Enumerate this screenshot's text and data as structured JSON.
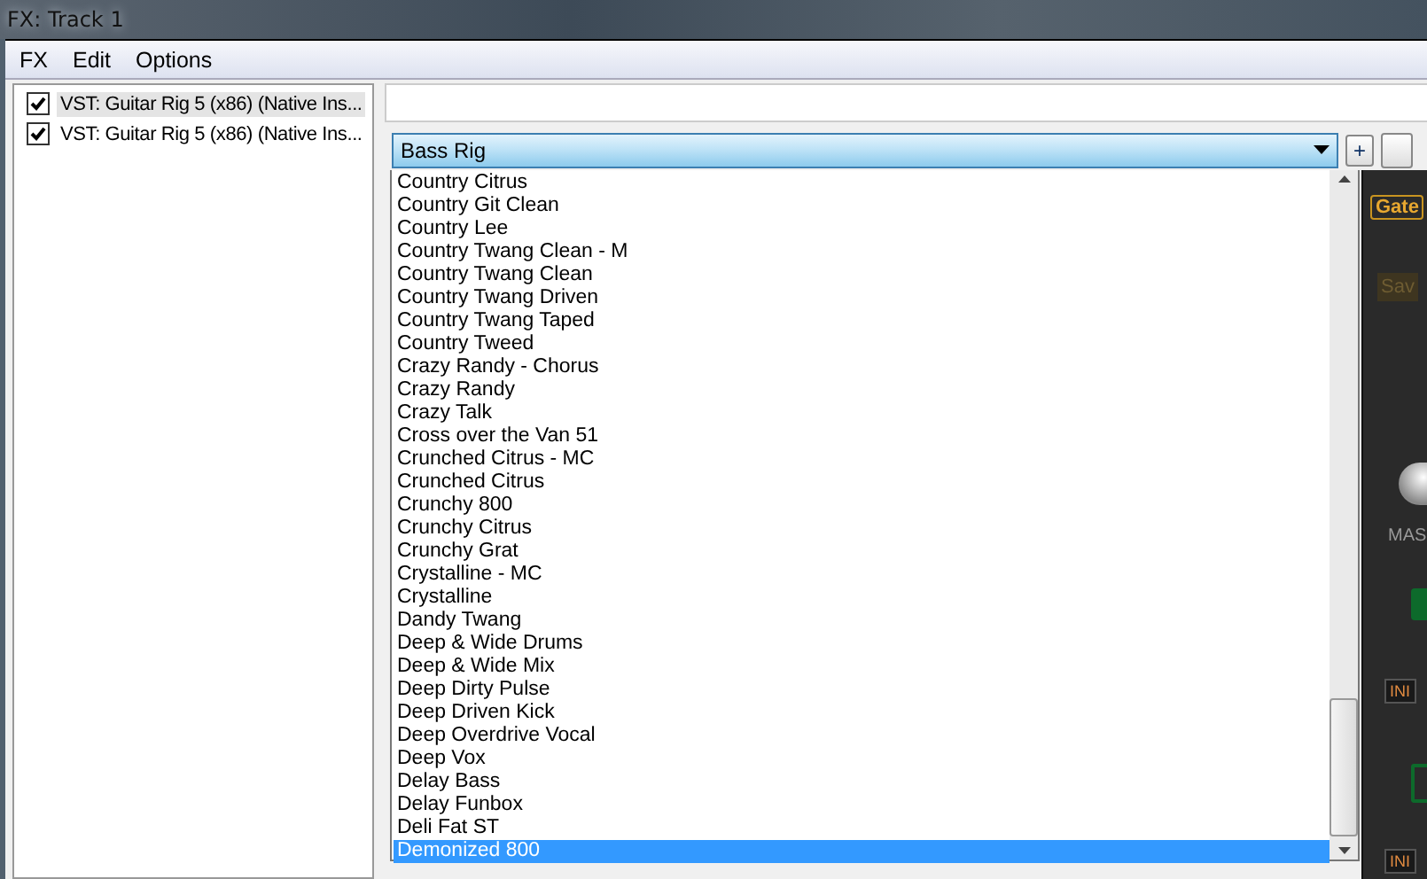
{
  "window": {
    "title": "FX: Track 1"
  },
  "menu": [
    "FX",
    "Edit",
    "Options"
  ],
  "fx_chain": [
    {
      "label": "VST: Guitar Rig 5 (x86) (Native Ins...",
      "checked": true,
      "selected": true
    },
    {
      "label": "VST: Guitar Rig 5 (x86) (Native Ins...",
      "checked": true,
      "selected": false
    }
  ],
  "preset": {
    "value": "Bass Rig",
    "add_button": "+"
  },
  "preset_list": [
    {
      "label": "Country Citrus",
      "selected": false
    },
    {
      "label": "Country Git Clean",
      "selected": false
    },
    {
      "label": "Country Lee",
      "selected": false
    },
    {
      "label": "Country Twang Clean - M",
      "selected": false
    },
    {
      "label": "Country Twang Clean",
      "selected": false
    },
    {
      "label": "Country Twang Driven",
      "selected": false
    },
    {
      "label": "Country Twang Taped",
      "selected": false
    },
    {
      "label": "Country Tweed",
      "selected": false
    },
    {
      "label": "Crazy Randy - Chorus",
      "selected": false
    },
    {
      "label": "Crazy Randy",
      "selected": false
    },
    {
      "label": "Crazy Talk",
      "selected": false
    },
    {
      "label": "Cross over the Van 51",
      "selected": false
    },
    {
      "label": "Crunched Citrus - MC",
      "selected": false
    },
    {
      "label": "Crunched Citrus",
      "selected": false
    },
    {
      "label": "Crunchy 800",
      "selected": false
    },
    {
      "label": "Crunchy Citrus",
      "selected": false
    },
    {
      "label": "Crunchy Grat",
      "selected": false
    },
    {
      "label": "Crystalline - MC",
      "selected": false
    },
    {
      "label": "Crystalline",
      "selected": false
    },
    {
      "label": "Dandy Twang",
      "selected": false
    },
    {
      "label": "Deep & Wide Drums",
      "selected": false
    },
    {
      "label": "Deep & Wide Mix",
      "selected": false
    },
    {
      "label": "Deep Dirty Pulse",
      "selected": false
    },
    {
      "label": "Deep Driven Kick",
      "selected": false
    },
    {
      "label": "Deep Overdrive Vocal",
      "selected": false
    },
    {
      "label": "Deep Vox",
      "selected": false
    },
    {
      "label": "Delay Bass",
      "selected": false
    },
    {
      "label": "Delay Funbox",
      "selected": false
    },
    {
      "label": "Deli Fat ST",
      "selected": false
    },
    {
      "label": "Demonized 800",
      "selected": true
    }
  ],
  "plugin": {
    "gate": "Gate",
    "save": "Sav",
    "master": "MAS",
    "init_tags": [
      "INI",
      "INI"
    ]
  }
}
